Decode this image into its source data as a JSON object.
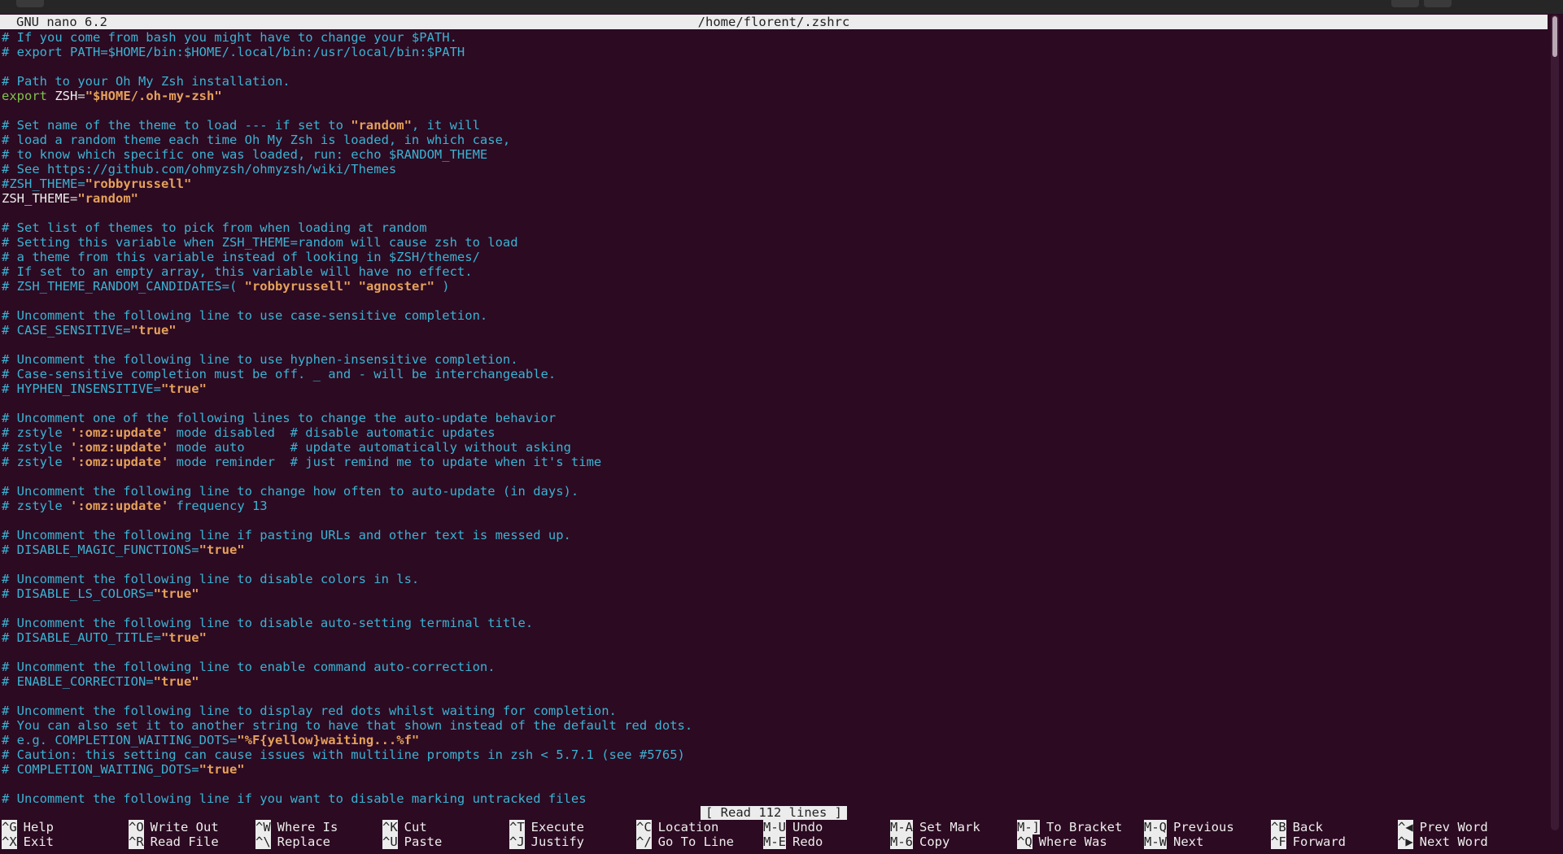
{
  "titlebar": {
    "version": "GNU nano 6.2",
    "path": "/home/florent/.zshrc"
  },
  "file_lines": [
    [
      [
        "c",
        "# If you come from bash you might have to change your $PATH."
      ]
    ],
    [
      [
        "c",
        "# export PATH=$HOME/bin:$HOME/.local/bin:/usr/local/bin:$PATH"
      ]
    ],
    [],
    [
      [
        "c",
        "# Path to your Oh My Zsh installation."
      ]
    ],
    [
      [
        "k",
        "export"
      ],
      [
        "t",
        " "
      ],
      [
        "w",
        "ZSH"
      ],
      [
        "t",
        "="
      ],
      [
        "s",
        "\"$HOME/.oh-my-zsh\""
      ]
    ],
    [],
    [
      [
        "c",
        "# Set name of the theme to load --- if set to "
      ],
      [
        "s",
        "\"random\""
      ],
      [
        "c",
        ", it will"
      ]
    ],
    [
      [
        "c",
        "# load a random theme each time Oh My Zsh is loaded, in which case,"
      ]
    ],
    [
      [
        "c",
        "# to know which specific one was loaded, run: echo $RANDOM_THEME"
      ]
    ],
    [
      [
        "c",
        "# See https://github.com/ohmyzsh/ohmyzsh/wiki/Themes"
      ]
    ],
    [
      [
        "c",
        "#ZSH_THEME="
      ],
      [
        "s",
        "\"robbyrussell\""
      ]
    ],
    [
      [
        "w",
        "ZSH_THEME"
      ],
      [
        "t",
        "="
      ],
      [
        "s",
        "\"random\""
      ]
    ],
    [],
    [
      [
        "c",
        "# Set list of themes to pick from when loading at random"
      ]
    ],
    [
      [
        "c",
        "# Setting this variable when ZSH_THEME=random will cause zsh to load"
      ]
    ],
    [
      [
        "c",
        "# a theme from this variable instead of looking in $ZSH/themes/"
      ]
    ],
    [
      [
        "c",
        "# If set to an empty array, this variable will have no effect."
      ]
    ],
    [
      [
        "c",
        "# ZSH_THEME_RANDOM_CANDIDATES=( "
      ],
      [
        "s",
        "\"robbyrussell\""
      ],
      [
        "c",
        " "
      ],
      [
        "s",
        "\"agnoster\""
      ],
      [
        "c",
        " )"
      ]
    ],
    [],
    [
      [
        "c",
        "# Uncomment the following line to use case-sensitive completion."
      ]
    ],
    [
      [
        "c",
        "# CASE_SENSITIVE="
      ],
      [
        "s",
        "\"true\""
      ]
    ],
    [],
    [
      [
        "c",
        "# Uncomment the following line to use hyphen-insensitive completion."
      ]
    ],
    [
      [
        "c",
        "# Case-sensitive completion must be off. _ and - will be interchangeable."
      ]
    ],
    [
      [
        "c",
        "# HYPHEN_INSENSITIVE="
      ],
      [
        "s",
        "\"true\""
      ]
    ],
    [],
    [
      [
        "c",
        "# Uncomment one of the following lines to change the auto-update behavior"
      ]
    ],
    [
      [
        "c",
        "# zstyle "
      ],
      [
        "s",
        "':omz:update'"
      ],
      [
        "c",
        " mode disabled  # disable automatic updates"
      ]
    ],
    [
      [
        "c",
        "# zstyle "
      ],
      [
        "s",
        "':omz:update'"
      ],
      [
        "c",
        " mode auto      # update automatically without asking"
      ]
    ],
    [
      [
        "c",
        "# zstyle "
      ],
      [
        "s",
        "':omz:update'"
      ],
      [
        "c",
        " mode reminder  # just remind me to update when it's time"
      ]
    ],
    [],
    [
      [
        "c",
        "# Uncomment the following line to change how often to auto-update (in days)."
      ]
    ],
    [
      [
        "c",
        "# zstyle "
      ],
      [
        "s",
        "':omz:update'"
      ],
      [
        "c",
        " frequency 13"
      ]
    ],
    [],
    [
      [
        "c",
        "# Uncomment the following line if pasting URLs and other text is messed up."
      ]
    ],
    [
      [
        "c",
        "# DISABLE_MAGIC_FUNCTIONS="
      ],
      [
        "s",
        "\"true\""
      ]
    ],
    [],
    [
      [
        "c",
        "# Uncomment the following line to disable colors in ls."
      ]
    ],
    [
      [
        "c",
        "# DISABLE_LS_COLORS="
      ],
      [
        "s",
        "\"true\""
      ]
    ],
    [],
    [
      [
        "c",
        "# Uncomment the following line to disable auto-setting terminal title."
      ]
    ],
    [
      [
        "c",
        "# DISABLE_AUTO_TITLE="
      ],
      [
        "s",
        "\"true\""
      ]
    ],
    [],
    [
      [
        "c",
        "# Uncomment the following line to enable command auto-correction."
      ]
    ],
    [
      [
        "c",
        "# ENABLE_CORRECTION="
      ],
      [
        "s",
        "\"true\""
      ]
    ],
    [],
    [
      [
        "c",
        "# Uncomment the following line to display red dots whilst waiting for completion."
      ]
    ],
    [
      [
        "c",
        "# You can also set it to another string to have that shown instead of the default red dots."
      ]
    ],
    [
      [
        "c",
        "# e.g. COMPLETION_WAITING_DOTS="
      ],
      [
        "s",
        "\"%F{yellow}waiting...%f\""
      ]
    ],
    [
      [
        "c",
        "# Caution: this setting can cause issues with multiline prompts in zsh < 5.7.1 (see #5765)"
      ]
    ],
    [
      [
        "c",
        "# COMPLETION_WAITING_DOTS="
      ],
      [
        "s",
        "\"true\""
      ]
    ],
    [],
    [
      [
        "c",
        "# Uncomment the following line if you want to disable marking untracked files"
      ]
    ]
  ],
  "status_message": "[ Read 112 lines ]",
  "shortcuts": [
    [
      {
        "key": "^G",
        "label": "Help"
      },
      {
        "key": "^X",
        "label": "Exit"
      }
    ],
    [
      {
        "key": "^O",
        "label": "Write Out"
      },
      {
        "key": "^R",
        "label": "Read File"
      }
    ],
    [
      {
        "key": "^W",
        "label": "Where Is"
      },
      {
        "key": "^\\",
        "label": "Replace"
      }
    ],
    [
      {
        "key": "^K",
        "label": "Cut"
      },
      {
        "key": "^U",
        "label": "Paste"
      }
    ],
    [
      {
        "key": "^T",
        "label": "Execute"
      },
      {
        "key": "^J",
        "label": "Justify"
      }
    ],
    [
      {
        "key": "^C",
        "label": "Location"
      },
      {
        "key": "^/",
        "label": "Go To Line"
      }
    ],
    [
      {
        "key": "M-U",
        "label": "Undo"
      },
      {
        "key": "M-E",
        "label": "Redo"
      }
    ],
    [
      {
        "key": "M-A",
        "label": "Set Mark"
      },
      {
        "key": "M-6",
        "label": "Copy"
      }
    ],
    [
      {
        "key": "M-]",
        "label": "To Bracket"
      },
      {
        "key": "^Q",
        "label": "Where Was"
      }
    ],
    [
      {
        "key": "M-Q",
        "label": "Previous"
      },
      {
        "key": "M-W",
        "label": "Next"
      }
    ],
    [
      {
        "key": "^B",
        "label": "Back"
      },
      {
        "key": "^F",
        "label": "Forward"
      }
    ],
    [
      {
        "key": "^◀",
        "label": "Prev Word"
      },
      {
        "key": "^▶",
        "label": "Next Word"
      }
    ]
  ],
  "colors": {
    "background": "#2c0a22",
    "comment": "#3ab3d2",
    "string": "#e5a15a",
    "keyword": "#7fc24c",
    "bar": "#ececec"
  }
}
